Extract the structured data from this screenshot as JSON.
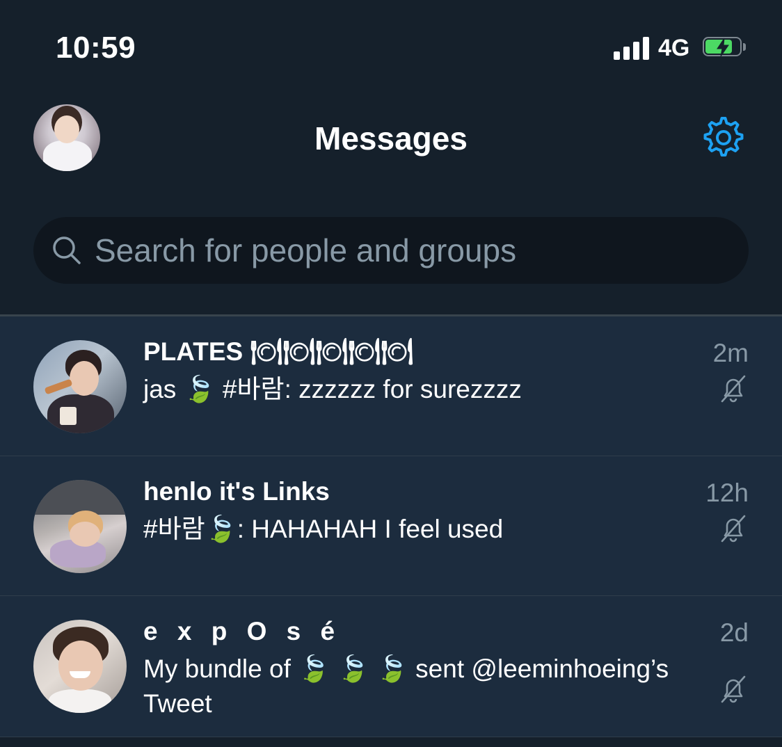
{
  "status_bar": {
    "time": "10:59",
    "network": "4G",
    "signal_bars": 4,
    "battery_charging": true,
    "battery_level_fraction": 0.8,
    "battery_fill_color": "#4cd964"
  },
  "header": {
    "title": "Messages",
    "settings_icon": "gear-icon",
    "accent_color": "#1da1f2"
  },
  "search": {
    "placeholder": "Search for people and groups",
    "value": ""
  },
  "conversations": [
    {
      "name": "PLATES 🍽🍽🍽🍽🍽",
      "preview": "jas 🍃 #바람: zzzzzz for surezzzz",
      "time": "2m",
      "muted": true
    },
    {
      "name": "henlo it's Links",
      "preview": "#바람🍃: HAHAHAH I feel used",
      "time": "12h",
      "muted": true
    },
    {
      "name": "e x p O s é",
      "preview": "My bundle of 🍃 🍃 🍃 sent @leeminhoeing’s Tweet",
      "time": "2d",
      "muted": true
    }
  ],
  "colors": {
    "background": "#15202b",
    "row_background": "#1c2c3e",
    "secondary_text": "#8899a6"
  }
}
